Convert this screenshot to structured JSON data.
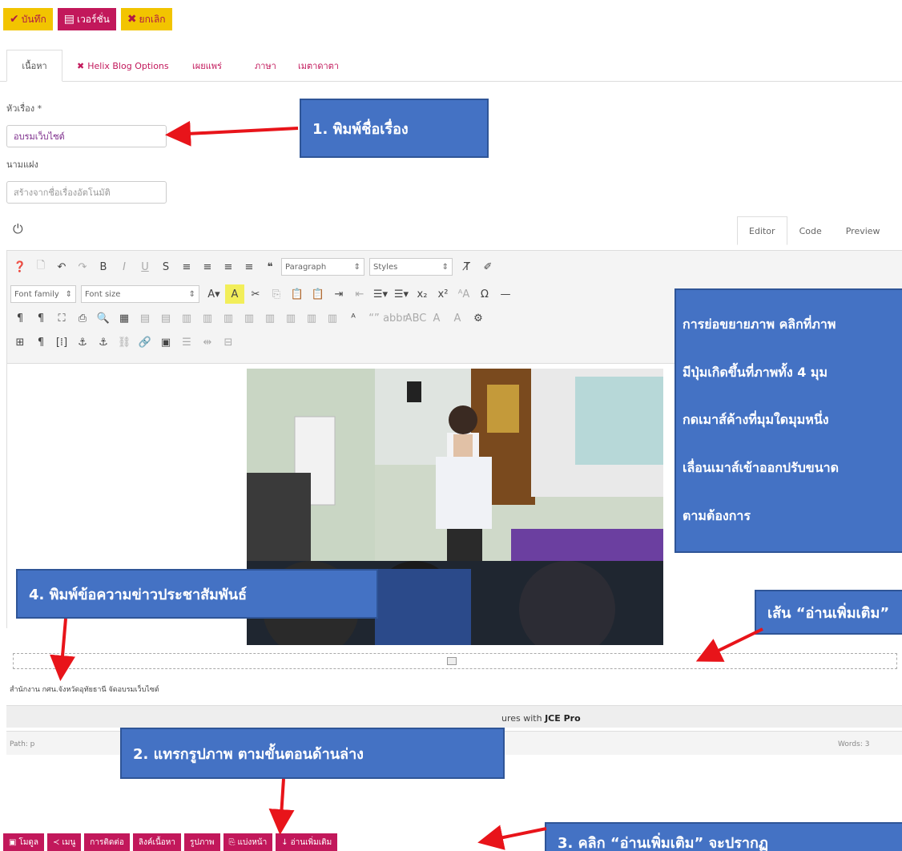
{
  "top_buttons": {
    "save": "บันทึก",
    "version": "เวอร์ชั่น",
    "cancel": "ยกเลิก"
  },
  "tabs": [
    "เนื้อหา",
    "Helix Blog Options",
    "เผยแพร่",
    "ภาษา",
    "เมตาดาตา"
  ],
  "form": {
    "title_label": "หัวเรื่อง *",
    "title_value": "อบรมเว็บไซต์",
    "alias_label": "นามแฝง",
    "alias_placeholder": "สร้างจากชื่อเรื่องอัตโนมัติ"
  },
  "editor": {
    "tabs": [
      "Editor",
      "Code",
      "Preview"
    ],
    "paragraph_select": "Paragraph",
    "styles_select": "Styles",
    "font_family_select": "Font family",
    "font_size_select": "Font size",
    "body_text": "สำนักงาน กศน.จังหวัดอุทัยธานี จัดอบรมเว็บไซต์",
    "jce_prefix": "ures with ",
    "jce_brand": "JCE Pro",
    "path_label": "Path: p",
    "words_label": "Words: 3"
  },
  "bottom_buttons": [
    "โมดูล",
    "เมนู",
    "การติดต่อ",
    "ลิงค์เนื้อหา",
    "รูปภาพ",
    "แบ่งหน้า",
    "อ่านเพิ่มเติม"
  ],
  "callouts": {
    "c1": "1. พิมพ์ชื่อเรื่อง",
    "c2_lines": [
      "การย่อขยายภาพ คลิกที่ภาพ",
      "มีปุ่มเกิดขึ้นที่ภาพทั้ง 4 มุม",
      "กดเมาส์ค้างที่มุมใดมุมหนึ่ง",
      "เลื่อนเมาส์เข้าออกปรับขนาด",
      "ตามต้องการ"
    ],
    "c3": "4. พิมพ์ข้อความข่าวประชาสัมพันธ์",
    "c4": "เส้น “อ่านเพิ่มเติม”",
    "c5": "2. แทรกรูปภาพ ตามขั้นตอนด้านล่าง",
    "c6": "3. คลิก “อ่านเพิ่มเติม” จะปรากฏ"
  },
  "colors": {
    "accent": "#c2185b",
    "yellow": "#f2c400",
    "callout_blue": "#4472c4",
    "arrow_red": "#e8141a"
  }
}
